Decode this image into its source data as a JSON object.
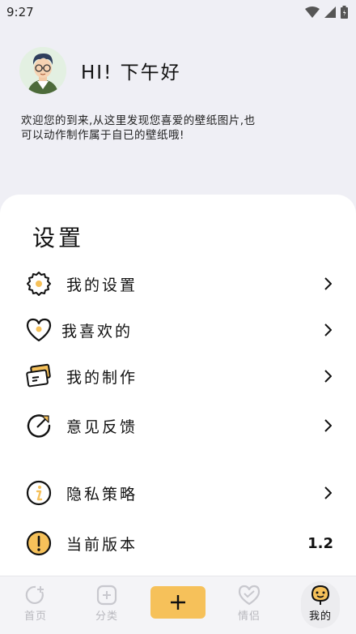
{
  "status_bar": {
    "time": "9:27"
  },
  "header": {
    "greeting": "HI! 下午好",
    "welcome": "欢迎您的到来,从这里发现您喜爱的壁纸图片,也可以动作制作属于自已的壁纸哦!"
  },
  "settings": {
    "title": "设置",
    "items": [
      {
        "label": "我的设置",
        "icon": "gear-icon"
      },
      {
        "label": "我喜欢的",
        "icon": "heart-icon"
      },
      {
        "label": "我的制作",
        "icon": "cards-icon"
      },
      {
        "label": "意见反馈",
        "icon": "feedback-icon"
      },
      {
        "label": "隐私策略",
        "icon": "info-icon"
      },
      {
        "label": "当前版本",
        "icon": "exclamation-icon",
        "value": "1.2"
      }
    ]
  },
  "bottom_nav": {
    "items": [
      {
        "label": "首页",
        "active": false
      },
      {
        "label": "分类",
        "active": false
      },
      {
        "label": "",
        "type": "add"
      },
      {
        "label": "情侣",
        "active": false
      },
      {
        "label": "我的",
        "active": true
      }
    ]
  },
  "colors": {
    "accent": "#f6c15a",
    "card": "#ffffff",
    "background": "#efeff5"
  }
}
